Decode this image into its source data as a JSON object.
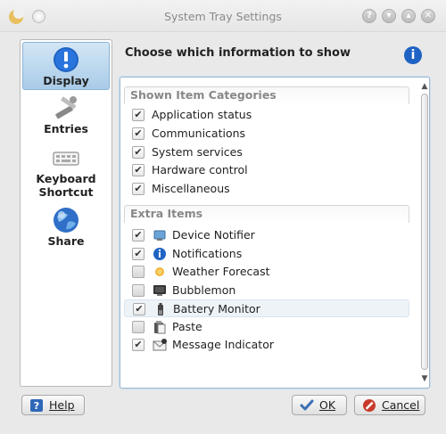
{
  "window": {
    "title": "System Tray Settings"
  },
  "sidebar": {
    "items": [
      {
        "label": "Display",
        "icon": "info-icon"
      },
      {
        "label": "Entries",
        "icon": "tools-icon"
      },
      {
        "label": "Keyboard Shortcut",
        "icon": "keyboard-icon"
      },
      {
        "label": "Share",
        "icon": "globe-icon"
      }
    ],
    "selected": "Display"
  },
  "main": {
    "header": "Choose which information to show",
    "categories_header": "Shown Item Categories",
    "categories": [
      {
        "label": "Application status",
        "checked": true
      },
      {
        "label": "Communications",
        "checked": true
      },
      {
        "label": "System services",
        "checked": true
      },
      {
        "label": "Hardware control",
        "checked": true
      },
      {
        "label": "Miscellaneous",
        "checked": true
      }
    ],
    "extra_header": "Extra Items",
    "extra_items": [
      {
        "label": "Device Notifier",
        "checked": true,
        "icon": "device-notifier-icon"
      },
      {
        "label": "Notifications",
        "checked": true,
        "icon": "info-icon"
      },
      {
        "label": "Weather Forecast",
        "checked": false,
        "icon": "sun-icon"
      },
      {
        "label": "Bubblemon",
        "checked": false,
        "icon": "monitor-icon"
      },
      {
        "label": "Battery Monitor",
        "checked": true,
        "icon": "battery-icon",
        "highlighted": true
      },
      {
        "label": "Paste",
        "checked": false,
        "icon": "paste-icon"
      },
      {
        "label": "Message Indicator",
        "checked": true,
        "icon": "mail-icon"
      }
    ]
  },
  "buttons": {
    "help": "Help",
    "ok": "OK",
    "cancel": "Cancel"
  },
  "glyphs": {
    "check": "✔",
    "scroll_up": "▲",
    "scroll_down": "▼",
    "minimize": "▾",
    "maximize": "▴",
    "close": "✕",
    "help_q": "?",
    "info": "i"
  },
  "colors": {
    "selection": "#a9cbe8",
    "info_blue": "#1f63c4",
    "cancel_red": "#c93a2a",
    "ok_blue": "#3b6fb6"
  }
}
